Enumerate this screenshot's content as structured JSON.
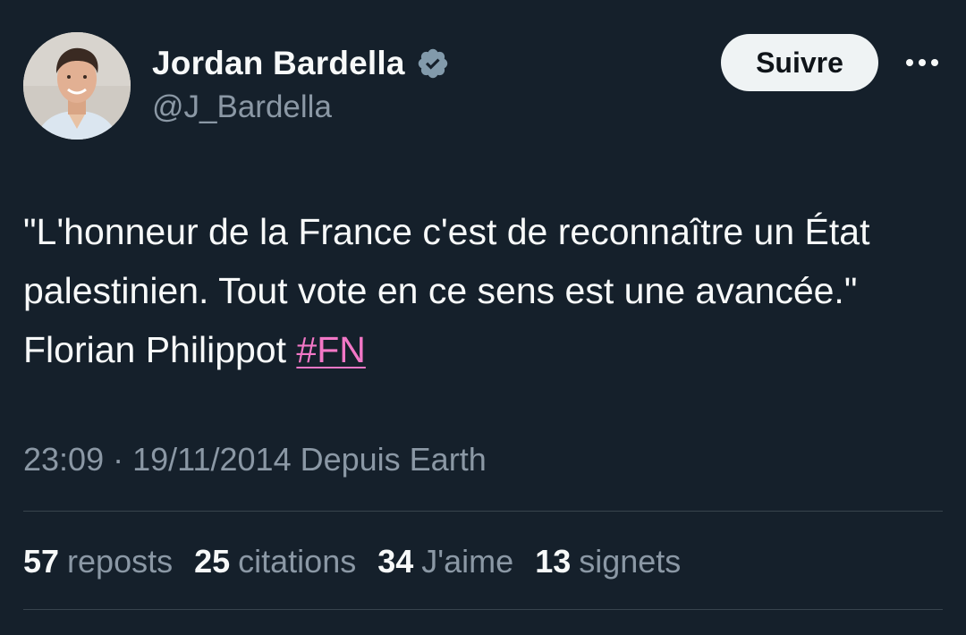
{
  "author": {
    "display_name": "Jordan Bardella",
    "handle": "@J_Bardella",
    "verified_icon": "verified-badge-icon",
    "avatar": "profile-photo"
  },
  "actions": {
    "follow_label": "Suivre",
    "more_icon": "more-options-icon"
  },
  "tweet": {
    "text": "\"L'honneur de la France c'est de reconnaître un État palestinien. Tout vote en ce sens est une avancée.\" Florian Philippot ",
    "hashtag": "#FN"
  },
  "meta": {
    "time": "23:09",
    "separator": "·",
    "date": "19/11/2014",
    "source": "Depuis Earth"
  },
  "stats": [
    {
      "count": "57",
      "label": "reposts"
    },
    {
      "count": "25",
      "label": "citations"
    },
    {
      "count": "34",
      "label": "J'aime"
    },
    {
      "count": "13",
      "label": "signets"
    }
  ],
  "colors": {
    "background": "#15202b",
    "text": "#f7f9f9",
    "secondary_text": "#8b98a5",
    "hashtag": "#f277c6",
    "divider": "#38444d",
    "follow_button_bg": "#eff3f4"
  }
}
